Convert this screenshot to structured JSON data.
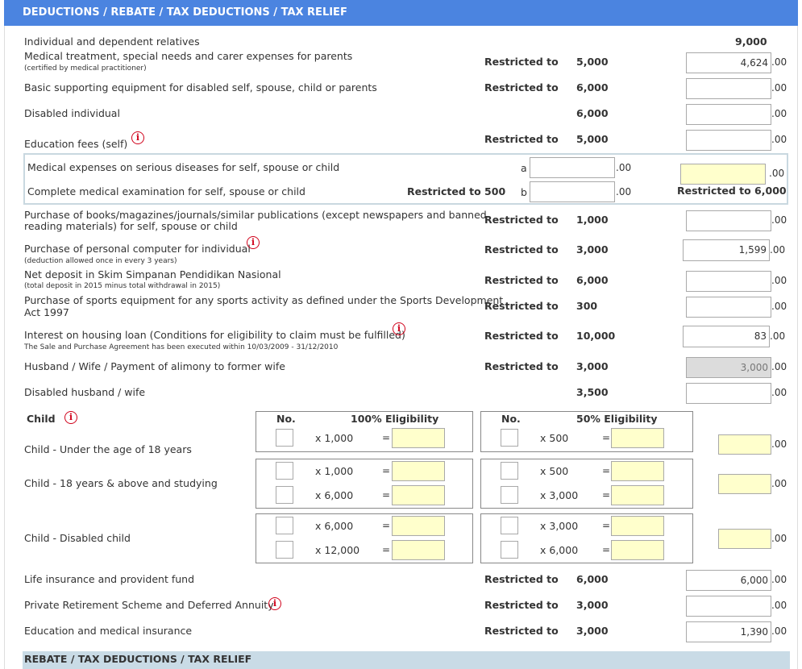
{
  "header": {
    "title": "DEDUCTIONS / REBATE / TAX DEDUCTIONS / TAX RELIEF"
  },
  "restricted_label": "Restricted to",
  "decimal": ".00",
  "rows": {
    "individual": {
      "label": "Individual and dependent relatives",
      "amount": "9,000"
    },
    "medical_parents": {
      "label": "Medical treatment, special needs and carer expenses for parents",
      "note": "(certified by medical practitioner)",
      "limit": "5,000",
      "value": "4,624"
    },
    "equipment": {
      "label": "Basic supporting equipment for disabled self, spouse, child or parents",
      "limit": "6,000",
      "value": ""
    },
    "disabled": {
      "label": "Disabled individual",
      "amount": "6,000",
      "value": ""
    },
    "education": {
      "label": "Education fees (self)",
      "limit": "5,000",
      "value": ""
    },
    "serious": {
      "label": "Medical expenses on serious diseases for self, spouse or child",
      "letter": "a",
      "value": "",
      "total": ""
    },
    "exam": {
      "label": "Complete medical examination for self, spouse or child",
      "restrict": "Restricted to 500",
      "letter": "b",
      "value": "",
      "restrict_total": "Restricted to 6,000"
    },
    "books": {
      "label1": "Purchase of books/magazines/journals/similar publications (except newspapers and banned",
      "label2": "reading materials) for self, spouse or child",
      "limit": "1,000",
      "value": ""
    },
    "computer": {
      "label": "Purchase of personal computer for individual",
      "note": "(deduction allowed once in every 3 years)",
      "limit": "3,000",
      "value": "1,599"
    },
    "sspn": {
      "label": "Net deposit in Skim Simpanan Pendidikan Nasional",
      "note": "(total deposit in 2015 minus total withdrawal in 2015)",
      "limit": "6,000",
      "value": ""
    },
    "sports": {
      "label1": "Purchase of sports equipment for any sports activity as defined under the Sports Development",
      "label2": "Act 1997",
      "limit": "300",
      "value": ""
    },
    "housing": {
      "label": "Interest on housing loan (Conditions for eligibility to claim must be fulfilled)",
      "note": "The Sale and Purchase Agreement has been executed within 10/03/2009 - 31/12/2010",
      "limit": "10,000",
      "value": "83"
    },
    "spouse": {
      "label": "Husband / Wife / Payment of alimony to former wife",
      "limit": "3,000",
      "value": "3,000"
    },
    "disabled_spouse": {
      "label": "Disabled husband / wife",
      "amount": "3,500",
      "value": ""
    },
    "life": {
      "label": "Life insurance and provident fund",
      "limit": "6,000",
      "value": "6,000"
    },
    "prs": {
      "label": "Private Retirement Scheme and Deferred Annuity",
      "limit": "3,000",
      "value": ""
    },
    "edu_med": {
      "label": "Education and medical insurance",
      "limit": "3,000",
      "value": "1,390"
    }
  },
  "child": {
    "title": "Child",
    "col_no": "No.",
    "col_100": "100% Eligibility",
    "col_50": "50% Eligibility",
    "eq": "=",
    "under18": {
      "label": "Child - Under the age of 18 years",
      "m100": "x 1,000",
      "m50": "x 500"
    },
    "studying": {
      "label": "Child - 18 years & above and studying",
      "m100a": "x 1,000",
      "m100b": "x 6,000",
      "m50a": "x 500",
      "m50b": "x 3,000"
    },
    "disabled": {
      "label": "Child - Disabled child",
      "m100a": "x 6,000",
      "m100b": "x 12,000",
      "m50a": "x 3,000",
      "m50b": "x 6,000"
    }
  },
  "footer": {
    "title": "REBATE / TAX DEDUCTIONS / TAX RELIEF"
  },
  "colors": {
    "header_bg": "#4b84e0",
    "footer_bg": "#c9dbe6",
    "info_icon": "#d0021b",
    "highlight_input": "#ffffcc"
  }
}
